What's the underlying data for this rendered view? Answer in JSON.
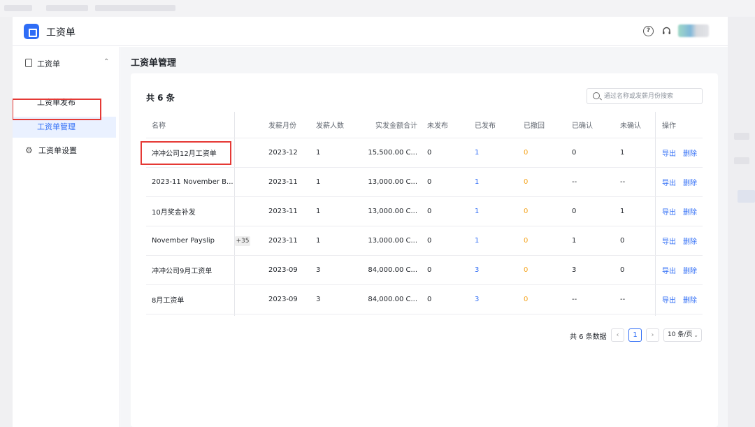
{
  "app": {
    "title": "工资单"
  },
  "sidebar": {
    "group_label": "工资单",
    "items": [
      {
        "label": "工资单发布"
      },
      {
        "label": "工资单管理"
      },
      {
        "label": "工资单设置"
      }
    ]
  },
  "main": {
    "page_title": "工资单管理",
    "total": "共 6 条",
    "search": {
      "placeholder": "通过名称或发薪月份搜索",
      "value": ""
    }
  },
  "table": {
    "columns": [
      "名称",
      "发薪月份",
      "发薪人数",
      "实发金额合计",
      "未发布",
      "已发布",
      "已撤回",
      "已确认",
      "未确认",
      "操作"
    ],
    "rows": [
      {
        "name": "冲冲公司12月工资单",
        "tag": "",
        "month": "2023-12",
        "people": "1",
        "amount": "15,500.00 C...",
        "unpublished": "0",
        "published": "1",
        "revoked": "0",
        "confirmed": "0",
        "unconfirmed": "1"
      },
      {
        "name": "2023-11 November B...",
        "tag": "",
        "month": "2023-11",
        "people": "1",
        "amount": "13,000.00 C...",
        "unpublished": "0",
        "published": "1",
        "revoked": "0",
        "confirmed": "--",
        "unconfirmed": "--"
      },
      {
        "name": "10月奖金补发",
        "tag": "",
        "month": "2023-11",
        "people": "1",
        "amount": "13,000.00 C...",
        "unpublished": "0",
        "published": "1",
        "revoked": "0",
        "confirmed": "0",
        "unconfirmed": "1"
      },
      {
        "name": "November Payslip",
        "tag": "+35",
        "month": "2023-11",
        "people": "1",
        "amount": "13,000.00 C...",
        "unpublished": "0",
        "published": "1",
        "revoked": "0",
        "confirmed": "1",
        "unconfirmed": "0"
      },
      {
        "name": "冲冲公司9月工资单",
        "tag": "",
        "month": "2023-09",
        "people": "3",
        "amount": "84,000.00 C...",
        "unpublished": "0",
        "published": "3",
        "revoked": "0",
        "confirmed": "3",
        "unconfirmed": "0"
      },
      {
        "name": "8月工资单",
        "tag": "",
        "month": "2023-09",
        "people": "3",
        "amount": "84,000.00 C...",
        "unpublished": "0",
        "published": "3",
        "revoked": "0",
        "confirmed": "--",
        "unconfirmed": "--"
      }
    ],
    "actions": {
      "export": "导出",
      "delete": "删除"
    }
  },
  "pagination": {
    "total": "共 6 条数据",
    "prev": "‹",
    "current": "1",
    "next": "›",
    "page_size": "10 条/页",
    "page_size_chevron": "⌄"
  },
  "icons": {
    "help": "?",
    "headset": "🎧",
    "settings": "⚙",
    "collapse": "⌃"
  },
  "colors": {
    "accent": "#2f6df6",
    "revoked": "#f5a623",
    "highlight": "#e53935"
  }
}
